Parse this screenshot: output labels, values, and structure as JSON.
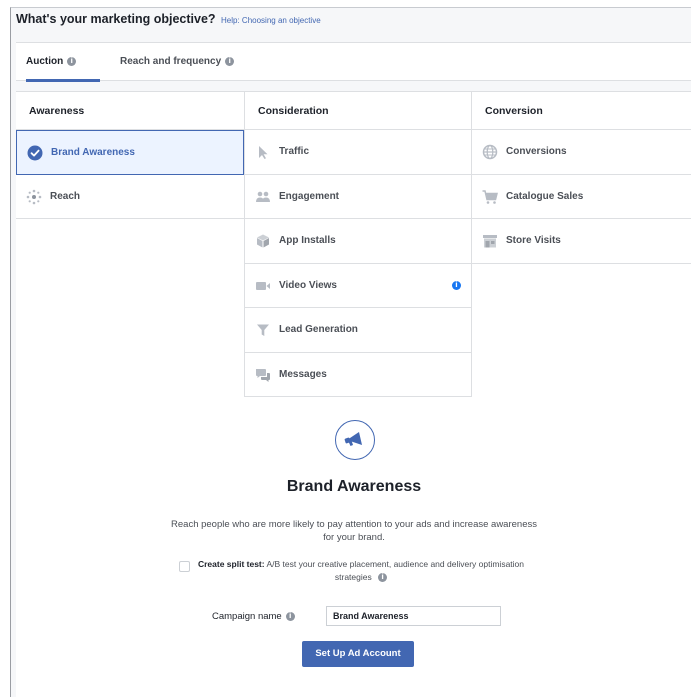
{
  "header": {
    "title": "What's your marketing objective?",
    "help": "Help: Choosing an objective"
  },
  "tabs": [
    {
      "label": "Auction",
      "active": true
    },
    {
      "label": "Reach and frequency",
      "active": false
    }
  ],
  "columns": [
    {
      "heading": "Awareness",
      "items": [
        {
          "label": "Brand Awareness",
          "icon": "check-circle-icon",
          "selected": true
        },
        {
          "label": "Reach",
          "icon": "reach-burst-icon",
          "selected": false
        }
      ]
    },
    {
      "heading": "Consideration",
      "items": [
        {
          "label": "Traffic",
          "icon": "cursor-icon"
        },
        {
          "label": "Engagement",
          "icon": "people-icon"
        },
        {
          "label": "App Installs",
          "icon": "box-icon"
        },
        {
          "label": "Video Views",
          "icon": "video-camera-icon"
        },
        {
          "label": "Lead Generation",
          "icon": "funnel-icon"
        },
        {
          "label": "Messages",
          "icon": "chat-bubbles-icon"
        }
      ]
    },
    {
      "heading": "Conversion",
      "items": [
        {
          "label": "Conversions",
          "icon": "globe-icon"
        },
        {
          "label": "Catalogue Sales",
          "icon": "shopping-cart-icon"
        },
        {
          "label": "Store Visits",
          "icon": "store-icon"
        }
      ]
    }
  ],
  "detail": {
    "icon": "megaphone-icon",
    "title": "Brand Awareness",
    "description": "Reach people who are more likely to pay attention to your ads and increase awareness for your brand.",
    "split_test_label": "Create split test:",
    "split_test_text": "A/B test your creative placement, audience and delivery optimisation strategies",
    "split_test_checked": false,
    "campaign_name_label": "Campaign name",
    "campaign_name_value": "Brand Awareness",
    "button_label": "Set Up Ad Account"
  },
  "colors": {
    "accent": "#4267b2",
    "selected_bg": "#ecf3ff",
    "info_blue": "#1877f2",
    "border": "#dddfe2"
  }
}
